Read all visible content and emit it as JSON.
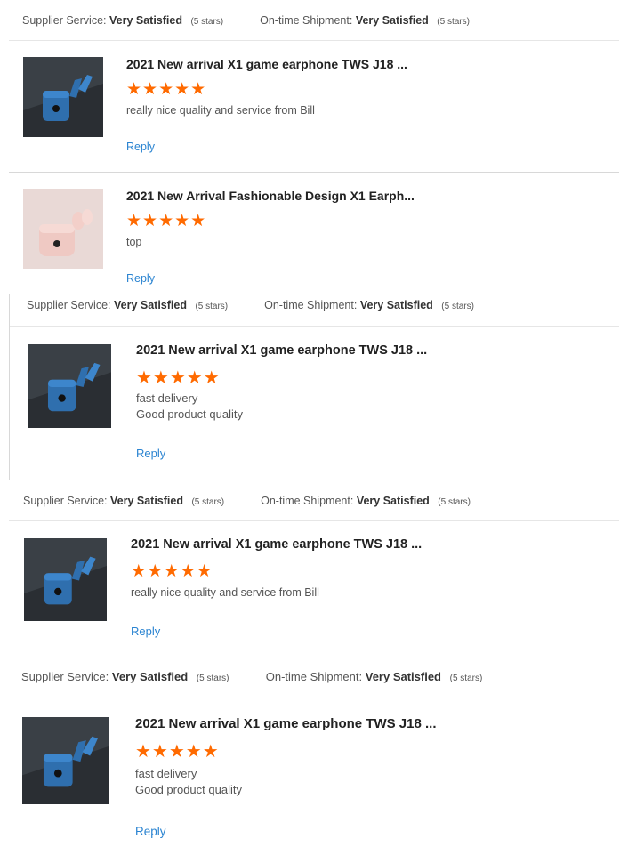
{
  "labels": {
    "supplier_service": "Supplier Service:",
    "ontime_shipment": "On-time Shipment:",
    "reply": "Reply"
  },
  "colors": {
    "star": "#ff6a00",
    "reply": "#2b84d1"
  },
  "star_icon": "★★★★★",
  "blocks": [
    {
      "supplier_value": "Very Satisfied",
      "supplier_stars": "(5 stars)",
      "shipment_value": "Very Satisfied",
      "shipment_stars": "(5 stars)",
      "reviews": [
        {
          "title": "2021 New arrival X1 game earphone TWS J18 ...",
          "rating": 5,
          "comment": [
            "really nice quality and service from Bill"
          ],
          "thumb": "blue-earphone-thumbnail"
        },
        {
          "title": "2021 New Arrival Fashionable Design X1 Earph...",
          "rating": 5,
          "comment": [
            "top"
          ],
          "thumb": "pink-earphone-thumbnail"
        }
      ]
    },
    {
      "supplier_value": "Very Satisfied",
      "supplier_stars": "(5 stars)",
      "shipment_value": "Very Satisfied",
      "shipment_stars": "(5 stars)",
      "reviews": [
        {
          "title": "2021 New arrival X1 game earphone TWS J18 ...",
          "rating": 5,
          "comment": [
            "fast delivery",
            "Good product quality"
          ],
          "thumb": "blue-earphone-thumbnail"
        }
      ]
    },
    {
      "supplier_value": "Very Satisfied",
      "supplier_stars": "(5 stars)",
      "shipment_value": "Very Satisfied",
      "shipment_stars": "(5 stars)",
      "reviews": [
        {
          "title": "2021 New arrival X1 game earphone TWS J18 ...",
          "rating": 5,
          "comment": [
            "really nice quality and service from Bill"
          ],
          "thumb": "blue-earphone-thumbnail"
        }
      ]
    },
    {
      "supplier_value": "Very Satisfied",
      "supplier_stars": "(5 stars)",
      "shipment_value": "Very Satisfied",
      "shipment_stars": "(5 stars)",
      "reviews": [
        {
          "title": "2021 New arrival X1 game earphone TWS J18 ...",
          "rating": 5,
          "comment": [
            "fast delivery",
            "Good product quality"
          ],
          "thumb": "blue-earphone-thumbnail"
        }
      ]
    }
  ]
}
